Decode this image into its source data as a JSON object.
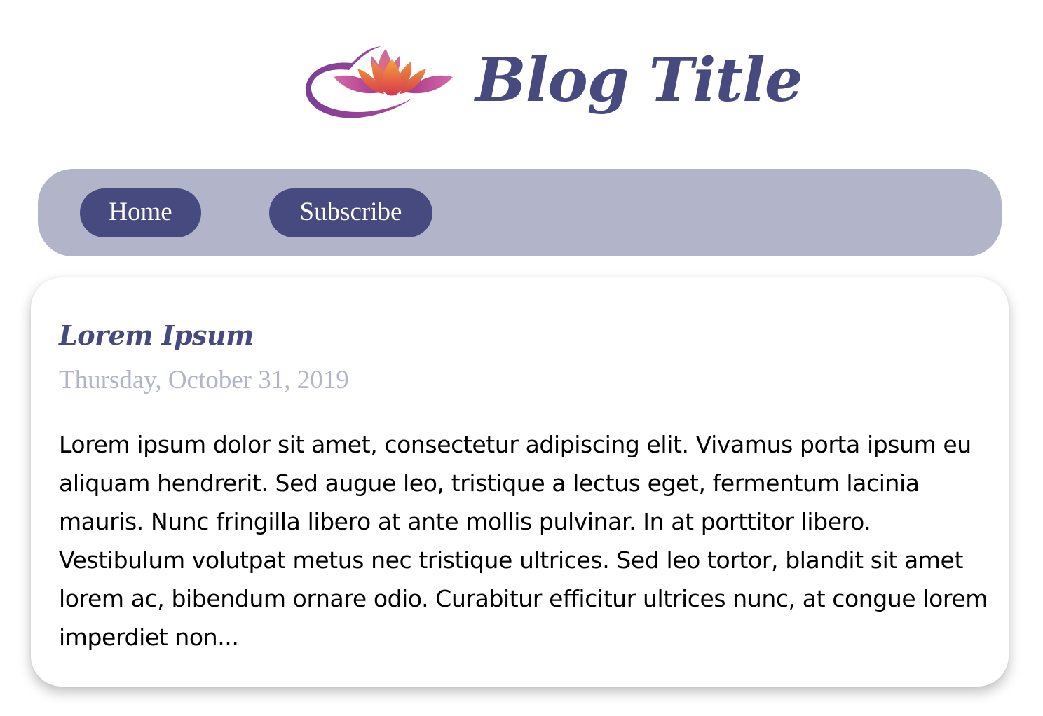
{
  "header": {
    "title": "Blog Title",
    "logo_icon": "lotus-logo-icon"
  },
  "nav": {
    "items": [
      {
        "label": "Home"
      },
      {
        "label": "Subscribe"
      }
    ]
  },
  "post": {
    "title": "Lorem Ipsum",
    "date": "Thursday, October 31, 2019",
    "excerpt": "Lorem ipsum dolor sit amet, consectetur adipiscing elit. Vivamus porta ipsum eu aliquam hendrerit. Sed augue leo, tristique a lectus eget, fermentum lacinia mauris. Nunc fringilla libero at ante mollis pulvinar. In at porttitor libero. Vestibulum volutpat metus nec tristique ultrices. Sed leo tortor, blandit sit amet lorem ac, bibendum ornare odio. Curabitur efficitur ultrices nunc, at congue lorem imperdiet non..."
  },
  "colors": {
    "brand": "#464a7e",
    "nav_background": "#b2b5c9",
    "date_text": "#b2b5c9",
    "body_text": "#000000",
    "background": "#ffffff"
  }
}
